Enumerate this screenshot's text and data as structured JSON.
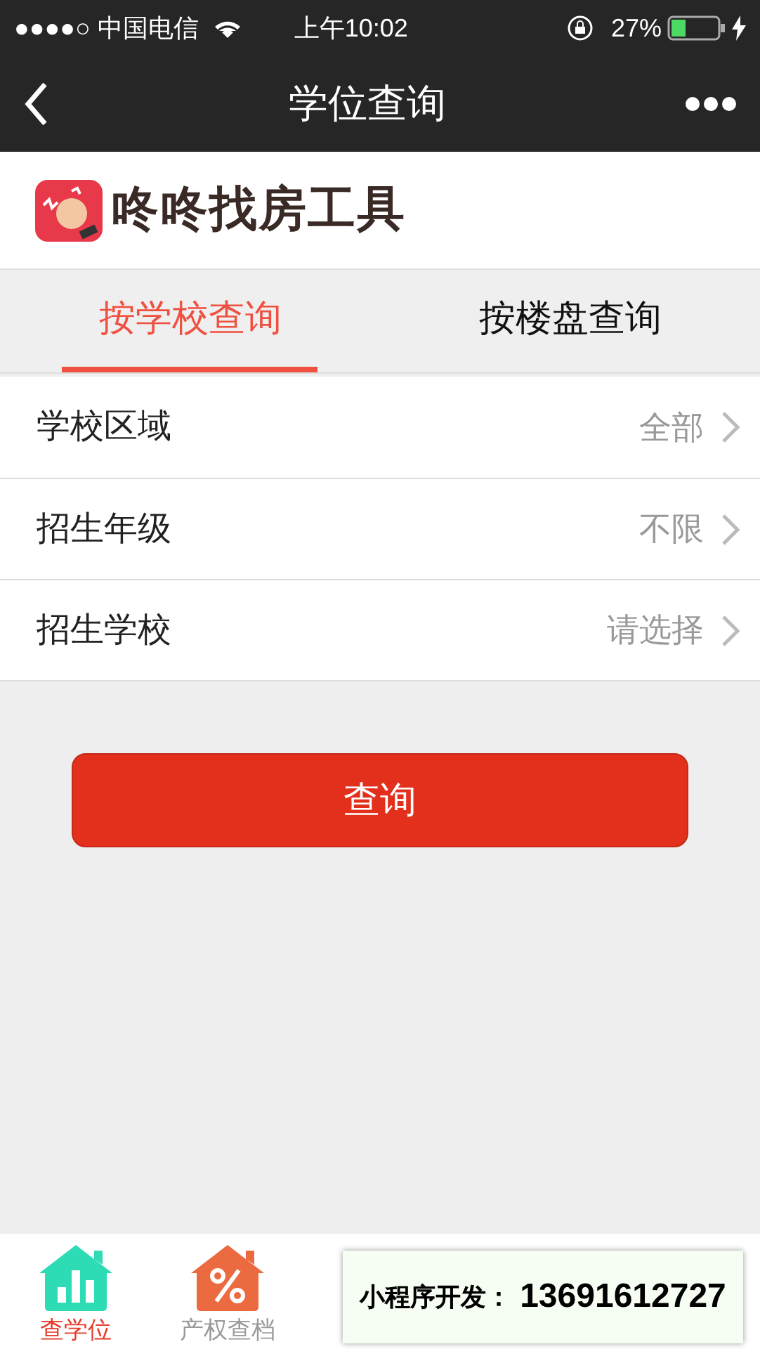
{
  "status_bar": {
    "carrier": "●●●●○ 中国电信",
    "time": "上午10:02",
    "battery": "27%"
  },
  "nav": {
    "title": "学位查询"
  },
  "brand": {
    "name": "咚咚找房工具"
  },
  "tabs": [
    {
      "label": "按学校查询",
      "selected": true
    },
    {
      "label": "按楼盘查询",
      "selected": false
    }
  ],
  "filters": [
    {
      "label": "学校区域",
      "value": "全部"
    },
    {
      "label": "招生年级",
      "value": "不限"
    },
    {
      "label": "招生学校",
      "value": "请选择"
    }
  ],
  "submit": "查询",
  "bottom_tabs": [
    {
      "kind": "chart",
      "label": "查学位",
      "selected": true,
      "color": "#2ddbb5"
    },
    {
      "kind": "percent",
      "label": "产权查档",
      "selected": false,
      "color": "#ec6a40"
    }
  ],
  "overlay": {
    "label": "小程序开发：",
    "phone": "13691612727"
  }
}
